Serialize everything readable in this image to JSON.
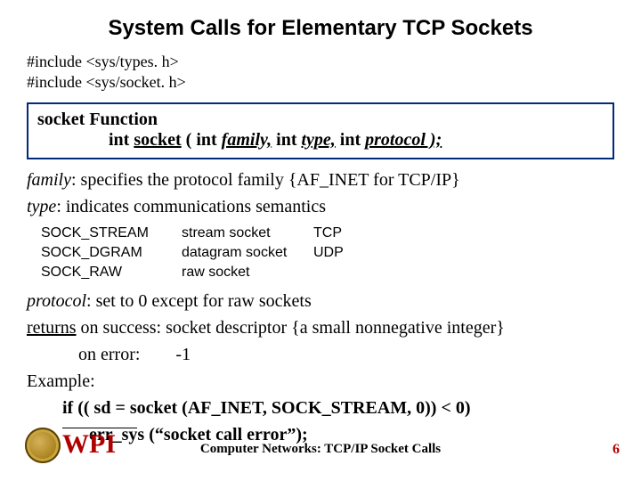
{
  "title": "System Calls for Elementary TCP Sockets",
  "includes": {
    "line1": "#include  <sys/types. h>",
    "line2": "#include  <sys/socket. h>"
  },
  "box": {
    "heading_prefix": "socket",
    "heading_rest": " Function",
    "sig_pre": "int   ",
    "sig_fn": "socket",
    "sig_open": "  ( int  ",
    "sig_p1": "family,",
    "sig_mid1": "  int  ",
    "sig_p2": "type,",
    "sig_mid2": " int  ",
    "sig_p3": "protocol );"
  },
  "desc": {
    "family_term": "family",
    "family_rest": ":  specifies the protocol family       {AF_INET for TCP/IP}",
    "type_term": "type",
    "type_rest": ":  indicates communications semantics"
  },
  "sock": {
    "r1c1": "SOCK_STREAM",
    "r1c2": "stream socket",
    "r1c3": "TCP",
    "r2c1": "SOCK_DGRAM",
    "r2c2": "datagram socket",
    "r2c3": "UDP",
    "r3c1": "SOCK_RAW",
    "r3c2": "raw socket",
    "r3c3": ""
  },
  "p2": {
    "protocol_term": "protocol",
    "protocol_rest": ": set to 0 except for raw sockets",
    "returns_lbl": "returns",
    "returns_succ": " on success:    socket descriptor  {a small nonnegative integer}",
    "err_lbl": "on error:",
    "err_val": "-1",
    "example_lbl": "Example:",
    "ex_line1": "if  (( sd = socket (AF_INET, SOCK_STREAM, 0)) < 0)",
    "ex_line2": "err_sys (“socket call error”);"
  },
  "footer": {
    "text": "Computer Networks: TCP/IP Socket Calls",
    "slidenum": "6",
    "logo_text": "WPI"
  }
}
